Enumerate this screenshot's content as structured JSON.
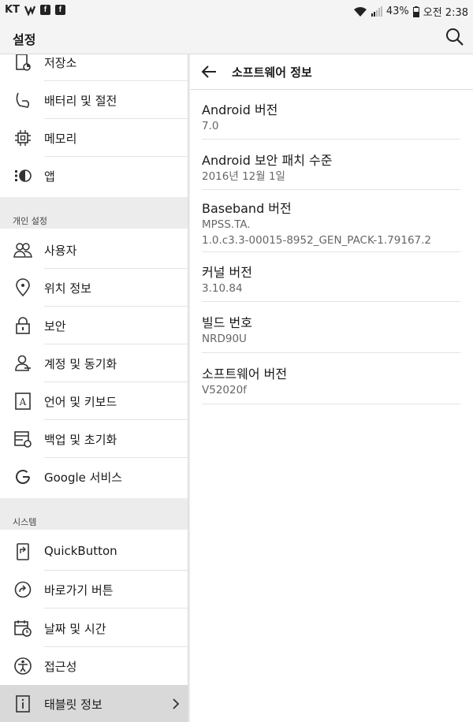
{
  "status_bar": {
    "carrier": "KT",
    "notif_icons": [
      "volte-icon",
      "facebook-icon",
      "facebook-icon"
    ],
    "battery": "43%",
    "time": "오전 2:38"
  },
  "app_bar": {
    "title": "설정"
  },
  "sidebar": {
    "items_top": [
      {
        "label": "저장소",
        "icon": "storage-icon"
      },
      {
        "label": "배터리 및 절전",
        "icon": "battery-icon"
      },
      {
        "label": "메모리",
        "icon": "memory-chip-icon"
      },
      {
        "label": "앱",
        "icon": "apps-icon"
      }
    ],
    "section_personal": "개인 설정",
    "items_personal": [
      {
        "label": "사용자",
        "icon": "users-icon"
      },
      {
        "label": "위치 정보",
        "icon": "location-pin-icon"
      },
      {
        "label": "보안",
        "icon": "lock-icon"
      },
      {
        "label": "계정 및 동기화",
        "icon": "account-sync-icon"
      },
      {
        "label": "언어 및 키보드",
        "icon": "language-keyboard-icon"
      },
      {
        "label": "백업 및 초기화",
        "icon": "backup-reset-icon"
      },
      {
        "label": "Google 서비스",
        "icon": "google-icon"
      }
    ],
    "section_system": "시스템",
    "items_system": [
      {
        "label": "QuickButton",
        "icon": "quickbutton-icon"
      },
      {
        "label": "바로가기 버튼",
        "icon": "shortcut-icon"
      },
      {
        "label": "날짜 및 시간",
        "icon": "calendar-clock-icon"
      },
      {
        "label": "접근성",
        "icon": "accessibility-icon"
      },
      {
        "label": "태블릿 정보",
        "icon": "info-icon",
        "selected": true
      }
    ]
  },
  "detail": {
    "title": "소프트웨어 정보",
    "rows": [
      {
        "title": "Android 버전",
        "value": "7.0"
      },
      {
        "title": "Android 보안 패치 수준",
        "value": "2016년 12월 1일"
      },
      {
        "title": "Baseband 버전",
        "value_line1": "MPSS.TA.",
        "value_line2": "1.0.c3.3-00015-8952_GEN_PACK-1.79167.2"
      },
      {
        "title": "커널 버전",
        "value": "3.10.84"
      },
      {
        "title": "빌드 번호",
        "value": "NRD90U"
      },
      {
        "title": "소프트웨어 버전",
        "value": "V52020f"
      }
    ]
  }
}
